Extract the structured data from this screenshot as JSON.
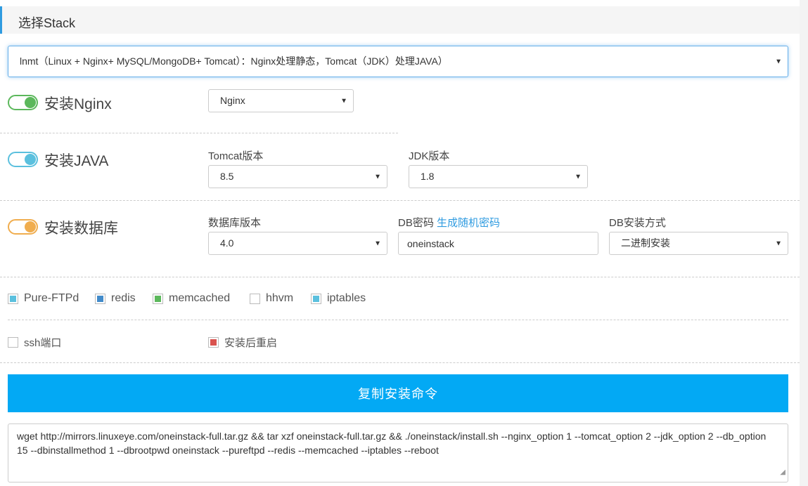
{
  "header": {
    "title": "选择Stack"
  },
  "stack": {
    "selected": "lnmt（Linux + Nginx+ MySQL/MongoDB+ Tomcat）：Nginx处理静态，Tomcat（JDK）处理JAVA）"
  },
  "nginx": {
    "toggle_label": "安装Nginx",
    "toggle_color": "#5cb85c",
    "select_value": "Nginx"
  },
  "java": {
    "toggle_label": "安装JAVA",
    "toggle_color": "#5bc0de",
    "tomcat_label": "Tomcat版本",
    "tomcat_value": "8.5",
    "jdk_label": "JDK版本",
    "jdk_value": "1.8"
  },
  "database": {
    "toggle_label": "安装数据库",
    "toggle_color": "#f0ad4e",
    "version_label": "数据库版本",
    "version_value": "4.0",
    "password_label": "DB密码",
    "random_link": "生成随机密码",
    "password_value": "oneinstack",
    "method_label": "DB安装方式",
    "method_value": "二进制安装"
  },
  "options": {
    "pureftpd": {
      "label": "Pure-FTPd",
      "color": "#5bc0de",
      "checked": true
    },
    "redis": {
      "label": "redis",
      "color": "#428bca",
      "checked": true
    },
    "memcached": {
      "label": "memcached",
      "color": "#5cb85c",
      "checked": true
    },
    "hhvm": {
      "label": "hhvm",
      "checked": false
    },
    "iptables": {
      "label": "iptables",
      "color": "#5bc0de",
      "checked": true
    }
  },
  "extra": {
    "ssh": {
      "label": "ssh端口",
      "checked": false
    },
    "reboot": {
      "label": "安装后重启",
      "color": "#d9534f",
      "checked": true
    }
  },
  "copy_button": "复制安装命令",
  "command": "wget http://mirrors.linuxeye.com/oneinstack-full.tar.gz && tar xzf oneinstack-full.tar.gz && ./oneinstack/install.sh --nginx_option 1 --tomcat_option 2 --jdk_option 2 --db_option 15 --dbinstallmethod 1 --dbrootpwd oneinstack --pureftpd  --redis  --memcached  --iptables  --reboot"
}
